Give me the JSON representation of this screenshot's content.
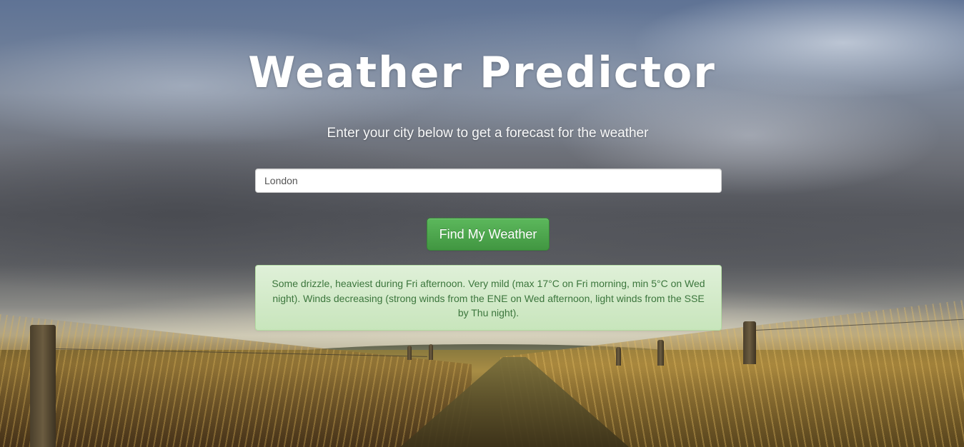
{
  "page": {
    "title": "Weather Predictor",
    "subtitle": "Enter your city below to get a forecast for the weather"
  },
  "search": {
    "value": "London",
    "button_label": "Find My Weather"
  },
  "forecast": {
    "text": "Some drizzle, heaviest during Fri afternoon. Very mild (max 17°C on Fri morning, min 5°C on Wed night). Winds decreasing (strong winds from the ENE on Wed afternoon, light winds from the SSE by Thu night)."
  },
  "colors": {
    "title_text": "#ffffff",
    "button_green": "#5cb85c",
    "alert_background": "#dff0d8",
    "alert_text": "#3c763d"
  },
  "background": {
    "scene": "cloudy-sky-over-grass-field-with-fence-posts"
  }
}
